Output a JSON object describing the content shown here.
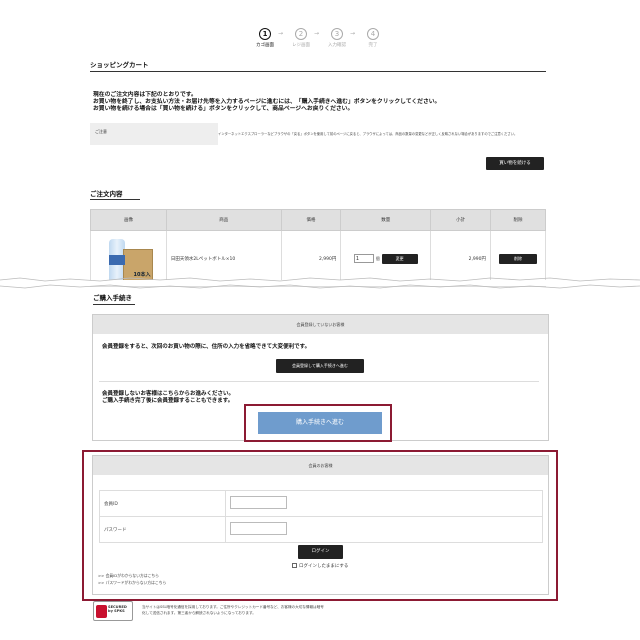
{
  "steps": [
    {
      "num": "1",
      "label": "カゴ画面",
      "state": "active"
    },
    {
      "num": "2",
      "label": "レジ画面",
      "state": "inactive"
    },
    {
      "num": "3",
      "label": "入力確認",
      "state": "inactive"
    },
    {
      "num": "4",
      "label": "完了",
      "state": "inactive"
    }
  ],
  "arrow": "→",
  "cart": {
    "title": "ショッピングカート",
    "intro": [
      "現在のご注文内容は下記のとおりです。",
      "お買い物を終了し、お支払い方法・お届け先等を入力するページに進むには、「購入手続きへ進む」ボタンをクリックしてください。",
      "お買い物を続ける場合は「買い物を続ける」ボタンをクリックして、商品ページへお戻りください。"
    ],
    "notice_label": "ご注意",
    "notice_text": "インターネットエクスプローラーなどブラウザの「戻る」ボタンを使用して前のページに戻ると、ブラウザによっては、商品の数量の変更などが正しく反映されない場合がありますのでご注意ください。",
    "continue_button": "買い物を続ける"
  },
  "order": {
    "title": "ご注文内容",
    "headers": [
      "画像",
      "商品",
      "価格",
      "数量",
      "小計",
      "削除"
    ],
    "row": {
      "name": "日田天領水2Lペットボトル×10",
      "price": "2,990円",
      "qty": "1",
      "qty_unit": "個",
      "change_button": "変更",
      "subtotal": "2,990円",
      "delete_button": "削除",
      "box_label": "10本入"
    }
  },
  "checkout": {
    "title": "ご購入手続き",
    "guest_panel_title": "会員登録していないお客様",
    "register_text": "会員登録をすると、次回のお買い物の際に、住所の入力を省略できて大変便利です。",
    "register_button": "会員登録して購入手続きへ進む",
    "guest_text": [
      "会員登録しないお客様はこちらからお進みください。",
      "ご購入手続き完了後に会員登録することもできます。"
    ],
    "proceed_button": "購入手続きへ進む",
    "member_panel_title": "会員のお客様",
    "member_id_label": "会員ID",
    "password_label": "パスワード",
    "login_button": "ログイン",
    "keep_login": "ログインしたままにする",
    "forgot_id": ">> 会員IDがわからない方はこちら",
    "forgot_pw": ">> パスワードがわからない方はこちら"
  },
  "ssl": {
    "badge_line1": "SECURED",
    "badge_line2": "by SPKS",
    "note_line1": "当サイトはSSL暗号化通信を採用しております。ご住所やクレジットカード番号など、お客様の大切な情報は暗号",
    "note_line2": "化して送信されます。第三者から解読されないようになっております。"
  },
  "colors": {
    "highlight": "#8c1a33",
    "proceed_button": "#6f9ccd",
    "dark_button": "#222222"
  }
}
